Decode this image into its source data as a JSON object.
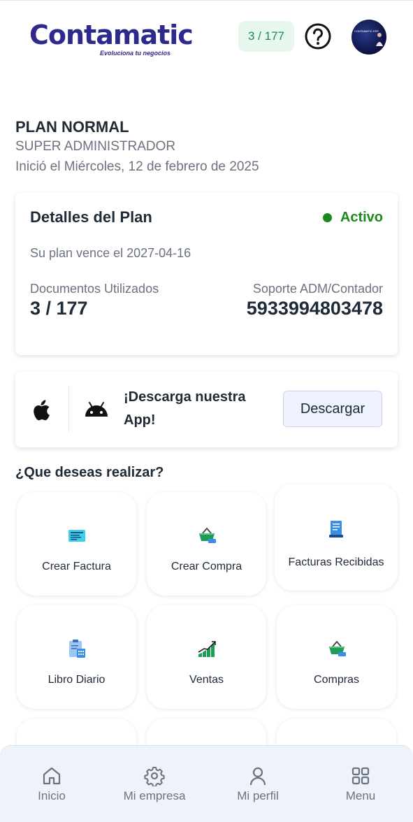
{
  "header": {
    "logo_text": "Contamatic",
    "logo_tagline": "Evoluciona tu negocios",
    "counter_badge": "3 / 177",
    "avatar_text": "CONTAMATIC ERP"
  },
  "plan": {
    "title": "PLAN NORMAL",
    "role": "SUPER ADMINISTRADOR",
    "start": "Inició el Miércoles, 12 de febrero de 2025"
  },
  "plan_card": {
    "title": "Detalles del Plan",
    "status": "Activo",
    "expiry": "Su plan vence el 2027-04-16",
    "docs_label": "Documentos Utilizados",
    "docs_value": "3 / 177",
    "support_label": "Soporte ADM/Contador",
    "support_value": "5933994803478"
  },
  "download": {
    "text": "¡Descarga nuestra App!",
    "button": "Descargar"
  },
  "actions": {
    "title": "¿Que deseas realizar?",
    "items": [
      {
        "label": "Crear Factura",
        "icon": "invoice-icon"
      },
      {
        "label": "Crear Compra",
        "icon": "basket-icon"
      },
      {
        "label": "Facturas Recibidas",
        "icon": "receipt-icon"
      },
      {
        "label": "Libro Diario",
        "icon": "clipboard-icon"
      },
      {
        "label": "Ventas",
        "icon": "sales-chart-icon"
      },
      {
        "label": "Compras",
        "icon": "basket-icon"
      }
    ]
  },
  "nav": {
    "items": [
      {
        "label": "Inicio",
        "icon": "home-icon"
      },
      {
        "label": "Mi empresa",
        "icon": "gear-icon"
      },
      {
        "label": "Mi perfil",
        "icon": "user-icon"
      },
      {
        "label": "Menu",
        "icon": "grid-icon"
      }
    ]
  },
  "colors": {
    "brand": "#2e2a8c",
    "active": "#1a8a1a",
    "badge_bg": "#e6f7ee",
    "badge_text": "#20894a"
  }
}
